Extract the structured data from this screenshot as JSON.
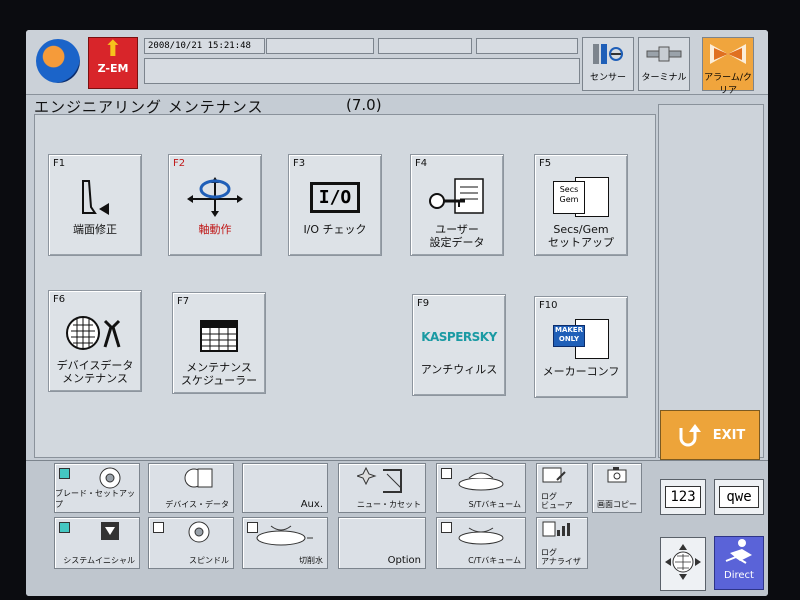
{
  "topbar": {
    "zem_label": "Z-EM",
    "datetime": "2008/10/21 15:21:48",
    "buttons": [
      {
        "label": "センサー",
        "icon": "sensor-icon"
      },
      {
        "label": "ターミナル",
        "icon": "terminal-icon"
      },
      {
        "label": "アラーム/クリア",
        "icon": "alarm-clear-icon"
      }
    ]
  },
  "header": {
    "title": "エンジニアリング メンテナンス",
    "version": "(7.0)"
  },
  "functions": [
    {
      "key": "F1",
      "label": "端面修正",
      "icon": "edge-correction-icon"
    },
    {
      "key": "F2",
      "label": "軸動作",
      "icon": "axis-motion-icon",
      "color": "#c01818"
    },
    {
      "key": "F3",
      "label": "I/O チェック",
      "icon": "io-icon",
      "icon_text": "I/O"
    },
    {
      "key": "F4",
      "label": "ユーザー\n設定データ",
      "icon": "user-settings-key-icon"
    },
    {
      "key": "F5",
      "label": "Secs/Gem\nセットアップ",
      "icon": "secs-gem-icon",
      "icon_text": "Secs\nGem"
    },
    {
      "key": "F6",
      "label": "デバイスデータ\nメンテナンス",
      "icon": "device-data-tools-icon"
    },
    {
      "key": "F7",
      "label": "メンテナンス\nスケジューラー",
      "icon": "calendar-icon"
    },
    {
      "key": "F9",
      "label": "アンチウィルス",
      "icon": "kaspersky-icon",
      "icon_text": "KASPERSKY"
    },
    {
      "key": "F10",
      "label": "メーカーコンフ",
      "icon": "maker-only-icon",
      "icon_text": "MAKER\nONLY"
    }
  ],
  "exit": {
    "label": "EXIT",
    "color": "#eda43a"
  },
  "bottom": {
    "blade_setup": "ブレード・セットアップ",
    "system_initial": "システムイニシャル",
    "device_data": "デバイス・データ",
    "spindle": "スピンドル",
    "aux": "Aux.",
    "cutting_water": "切削水",
    "new_cassette": "ニュー・カセット",
    "option": "Option",
    "st_vacuum": "S/Tバキューム",
    "ct_vacuum": "C/Tバキューム",
    "log_viewer": "ログ\nビューア",
    "screen_copy": "画面コピー",
    "log_analyzer": "ログ\nアナライザ",
    "key_123": "123",
    "key_qwe": "qwe",
    "direct": "Direct"
  },
  "colors": {
    "accent_orange": "#eda43a",
    "alarm_red": "#d8252a",
    "check_on": "#44c7c2",
    "direct_blue": "#5a63d8"
  }
}
